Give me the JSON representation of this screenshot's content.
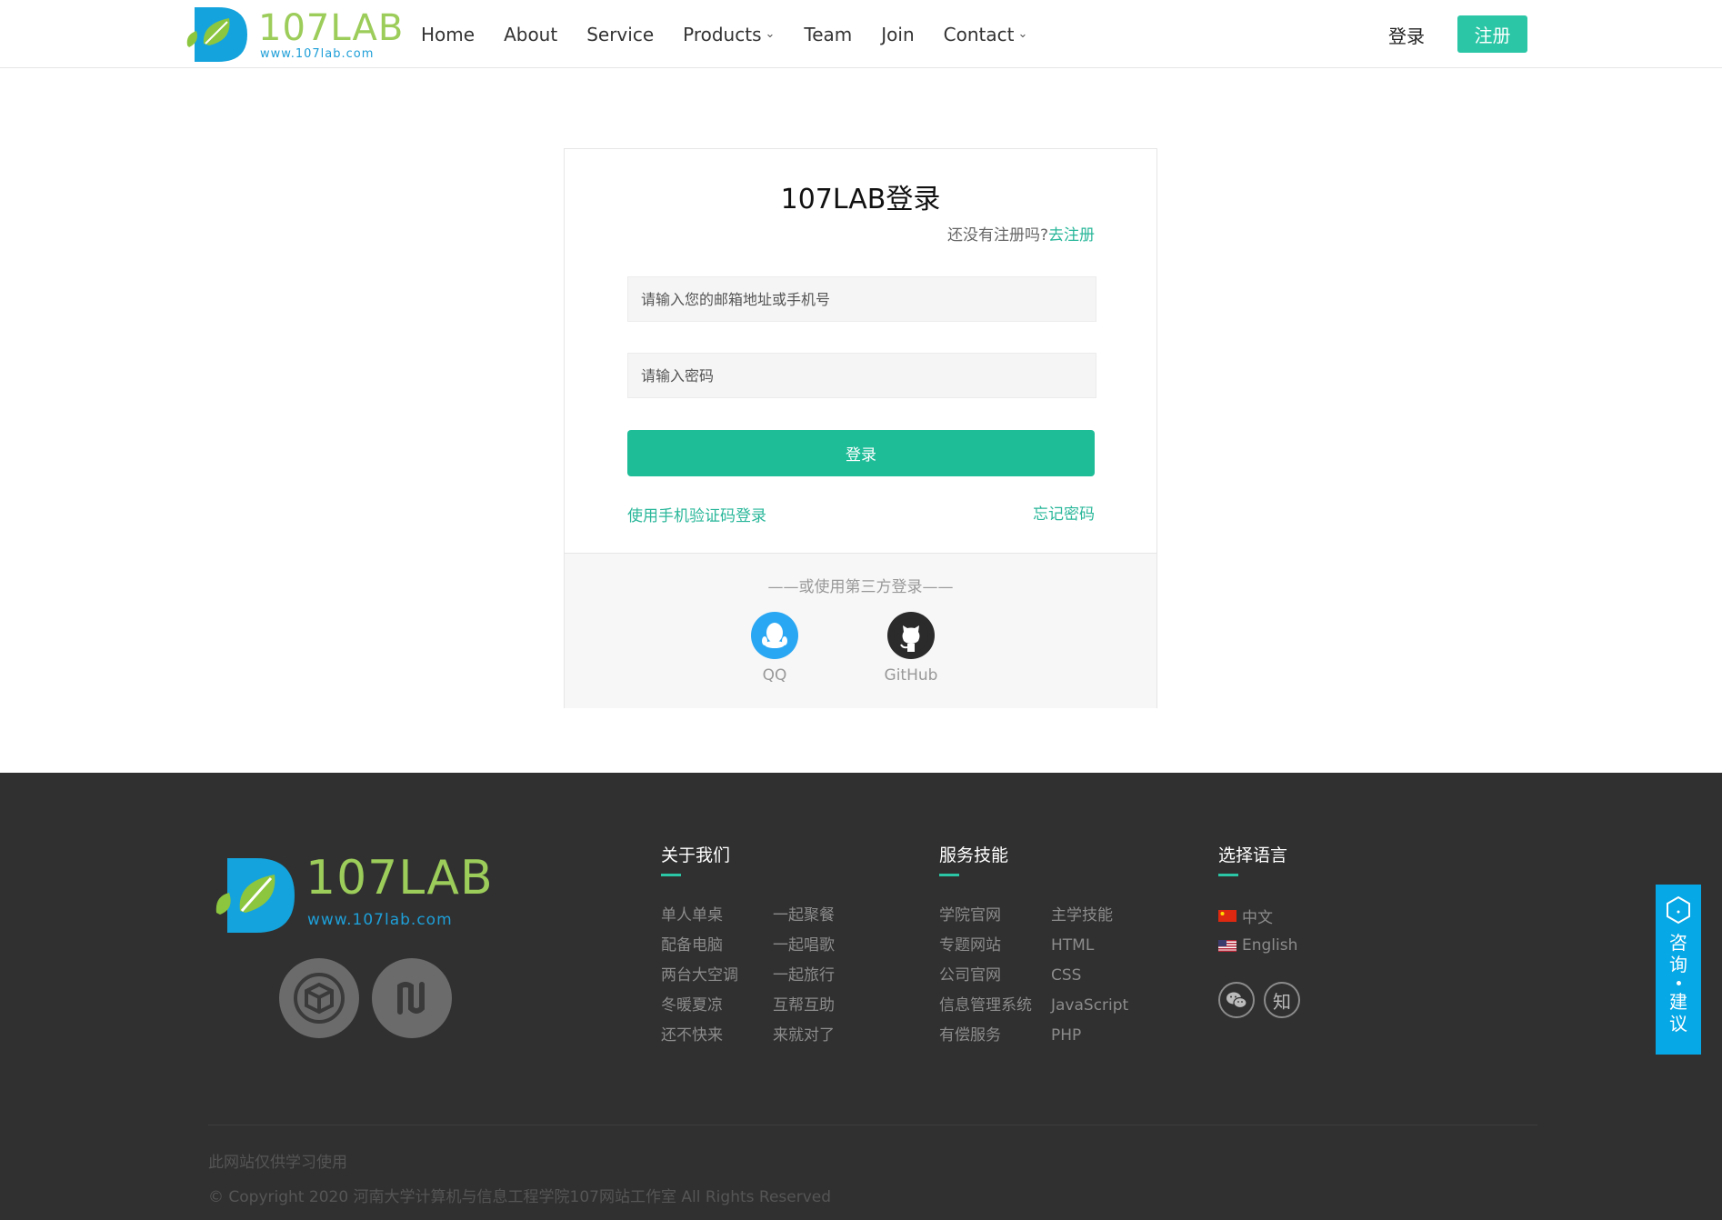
{
  "header": {
    "logo_text": "107LAB",
    "logo_url": "www.107lab.com",
    "nav": [
      {
        "label": "Home",
        "dropdown": false
      },
      {
        "label": "About",
        "dropdown": false
      },
      {
        "label": "Service",
        "dropdown": false
      },
      {
        "label": "Products",
        "dropdown": true
      },
      {
        "label": "Team",
        "dropdown": false
      },
      {
        "label": "Join",
        "dropdown": false
      },
      {
        "label": "Contact",
        "dropdown": true
      }
    ],
    "login_label": "登录",
    "register_label": "注册"
  },
  "login": {
    "title": "107LAB登录",
    "signup_prompt": "还没有注册吗?",
    "signup_link": "去注册",
    "email_placeholder": "请输入您的邮箱地址或手机号",
    "password_placeholder": "请输入密码",
    "submit_label": "登录",
    "sms_login_link": "使用手机验证码登录",
    "forgot_link": "忘记密码",
    "third_party_title": "——或使用第三方登录——",
    "providers": [
      {
        "label": "QQ",
        "icon": "qq-icon"
      },
      {
        "label": "GitHub",
        "icon": "github-icon"
      }
    ]
  },
  "footer": {
    "logo_text": "107LAB",
    "logo_url": "www.107lab.com",
    "about": {
      "title": "关于我们",
      "links": [
        "单人单桌",
        "一起聚餐",
        "配备电脑",
        "一起唱歌",
        "两台大空调",
        "一起旅行",
        "冬暖夏凉",
        "互帮互助",
        "还不快来",
        "来就对了"
      ]
    },
    "services": {
      "title": "服务技能",
      "links": [
        "学院官网",
        "主学技能",
        "专题网站",
        "HTML",
        "公司官网",
        "CSS",
        "信息管理系统",
        "JavaScript",
        "有偿服务",
        "PHP"
      ]
    },
    "language": {
      "title": "选择语言",
      "options": [
        "中文",
        "English"
      ]
    },
    "social_icons": [
      "wechat-icon",
      "zhihu-icon"
    ],
    "zhihu_glyph": "知",
    "note": "此网站仅供学习使用",
    "copyright": "© Copyright 2020 河南大学计算机与信息工程学院107网站工作室 All Rights Reserved"
  },
  "consult": {
    "chars_top": [
      "咨",
      "询"
    ],
    "chars_bottom": [
      "建",
      "议"
    ]
  },
  "colors": {
    "accent": "#2ac6a5",
    "button": "#1ebd98",
    "footer_bg": "#303030",
    "consult_bg": "#07a8e6",
    "qq_blue": "#2aa7f3"
  }
}
